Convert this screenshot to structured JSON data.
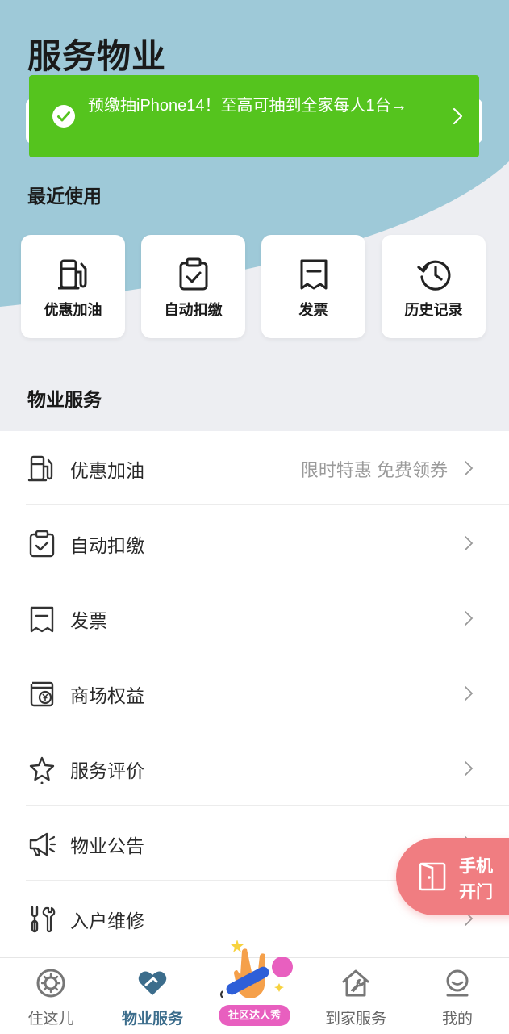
{
  "page": {
    "title": "服务物业"
  },
  "toast": {
    "text": "预缴抽iPhone14！至高可抽到全家每人1台→",
    "color": "#55c41e"
  },
  "recent": {
    "title": "最近使用",
    "items": [
      {
        "label": "优惠加油",
        "icon": "gas-pump-icon"
      },
      {
        "label": "自动扣缴",
        "icon": "clipboard-check-icon"
      },
      {
        "label": "发票",
        "icon": "receipt-icon"
      },
      {
        "label": "历史记录",
        "icon": "history-icon"
      }
    ]
  },
  "services": {
    "title": "物业服务",
    "items": [
      {
        "label": "优惠加油",
        "sub": "限时特惠 免费领券",
        "icon": "gas-pump-icon"
      },
      {
        "label": "自动扣缴",
        "sub": "",
        "icon": "clipboard-check-icon"
      },
      {
        "label": "发票",
        "sub": "",
        "icon": "receipt-icon"
      },
      {
        "label": "商场权益",
        "sub": "",
        "icon": "wallet-yuan-icon"
      },
      {
        "label": "服务评价",
        "sub": "",
        "icon": "star-rating-icon"
      },
      {
        "label": "物业公告",
        "sub": "",
        "icon": "megaphone-icon"
      },
      {
        "label": "入户维修",
        "sub": "",
        "icon": "repair-tools-icon"
      }
    ]
  },
  "door_button": {
    "label": "手机开门",
    "color": "#f07d81"
  },
  "tabbar": {
    "items": [
      {
        "label": "住这儿",
        "icon": "community-icon",
        "active": false
      },
      {
        "label": "物业服务",
        "icon": "heart-handshake-icon",
        "active": true
      },
      {
        "label": "社区达人秀",
        "icon": "rock-hand-icon",
        "active": false
      },
      {
        "label": "到家服务",
        "icon": "home-wrench-icon",
        "active": false
      },
      {
        "label": "我的",
        "icon": "profile-icon",
        "active": false
      }
    ]
  },
  "colors": {
    "hero": "#9ec9d8",
    "accent": "#3c6d8c",
    "badge": "#e85fbf"
  }
}
